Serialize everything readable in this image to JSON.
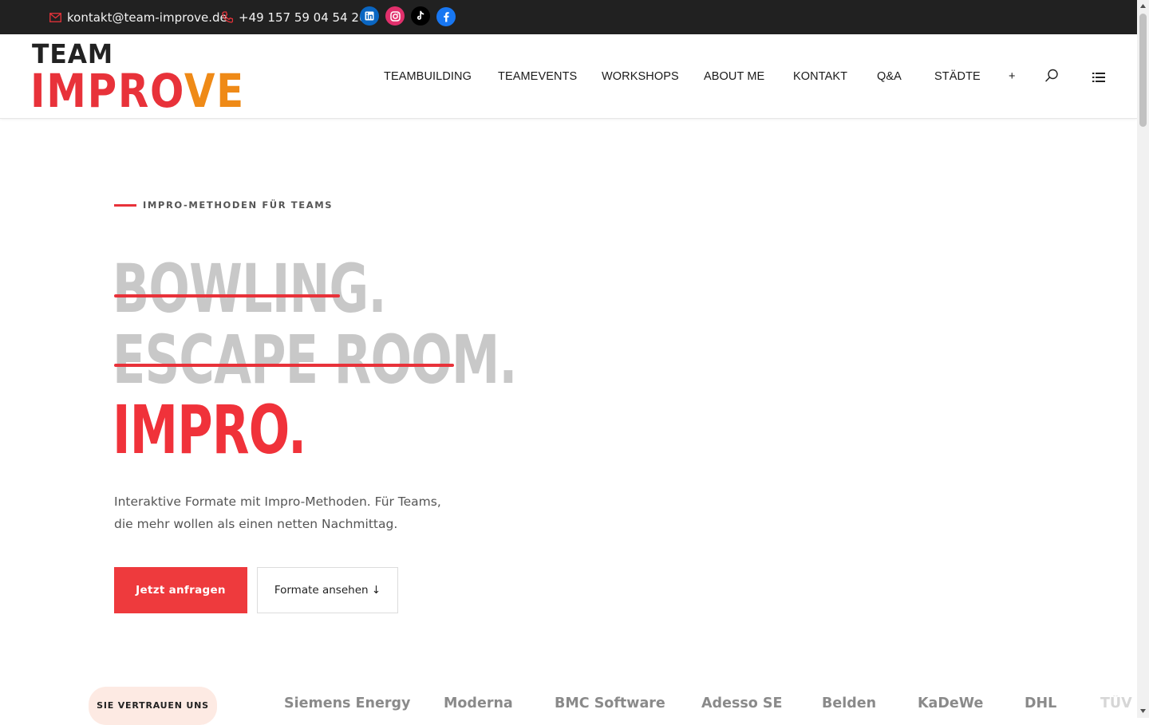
{
  "topbar": {
    "email": "kontakt@team-improve.de",
    "phone": "+49 157 59 04 54 20",
    "socials": [
      {
        "name": "linkedin",
        "icon": "linkedin-icon",
        "color": "#0a66c2"
      },
      {
        "name": "instagram",
        "icon": "instagram-icon",
        "color": "#e1306c"
      },
      {
        "name": "tiktok",
        "icon": "tiktok-icon",
        "color": "#000000"
      },
      {
        "name": "facebook",
        "icon": "facebook-icon",
        "color": "#1877f2"
      }
    ]
  },
  "logo": {
    "team": "TEAM",
    "improve_a": "IMPRO",
    "improve_b": "VE",
    "color_red": "#e8323a",
    "color_orange": "#ef8a17"
  },
  "nav": {
    "items": [
      "TEAMBUILDING",
      "TEAMEVENTS",
      "WORKSHOPS",
      "ABOUT ME",
      "KONTAKT",
      "Q&A",
      "STÄDTE",
      "+"
    ],
    "search_icon": "search-icon",
    "menu_icon": "list-menu-icon"
  },
  "hero": {
    "eyebrow": "IMPRO-METHODEN FÜR TEAMS",
    "line1": "BOWLING.",
    "line2": "ESCAPE ROOM.",
    "line3": "IMPRO.",
    "lead": "Interaktive Formate mit Impro-Methoden. Für Teams, die mehr wollen als einen netten Nachmittag.",
    "cta_primary": "Jetzt anfragen",
    "cta_secondary": "Formate ansehen ↓",
    "accent_color": "#e8323a",
    "muted_color": "#c8c8c8"
  },
  "trust": {
    "badge": "SIE VERTRAUEN UNS",
    "clients": [
      "Siemens Energy",
      "Moderna",
      "BMC Software",
      "Adesso SE",
      "Belden",
      "KaDeWe",
      "DHL",
      "TÜV"
    ]
  }
}
